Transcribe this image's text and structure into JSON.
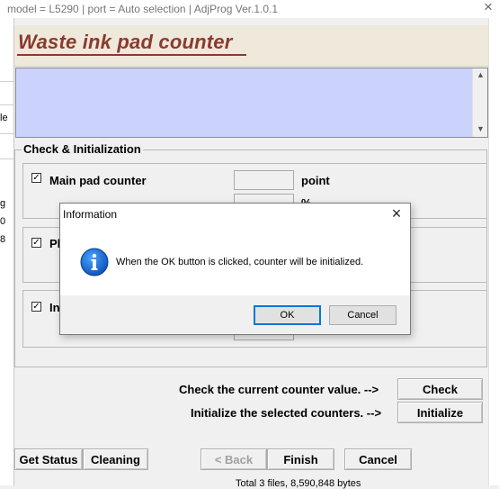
{
  "window": {
    "title": "model = L5290 | port = Auto selection | AdjProg Ver.1.0.1",
    "close_glyph": "×"
  },
  "background": {
    "left_fragments": [
      "",
      "le",
      "",
      "g",
      "0",
      "8"
    ],
    "bottom_text": "Total 3 files, 8,590,848 bytes"
  },
  "header": {
    "title": "Waste ink pad counter",
    "title_color": "#8b3a2e",
    "band_color": "#efe9dc"
  },
  "info_area": {
    "color": "#cbd2fb"
  },
  "check_group": {
    "legend": "Check & Initialization",
    "rows": [
      {
        "label": "Main pad counter",
        "checked": true,
        "unit1": "point",
        "unit2": "%"
      },
      {
        "label": "Pl",
        "checked": true
      },
      {
        "label": "In",
        "checked": true
      }
    ]
  },
  "actions": {
    "check_label": "Check the current counter value. -->",
    "check_button": "Check",
    "init_label": "Initialize the selected counters. -->",
    "init_button": "Initialize"
  },
  "bottom_buttons": {
    "get_status": "Get Status",
    "cleaning": "Cleaning",
    "back": "< Back",
    "finish": "Finish",
    "cancel": "Cancel"
  },
  "dialog": {
    "title": "Information",
    "message": "When the OK button is clicked, counter will be initialized.",
    "ok": "OK",
    "cancel": "Cancel",
    "icon": "info-icon",
    "accent": "#0078d7"
  }
}
